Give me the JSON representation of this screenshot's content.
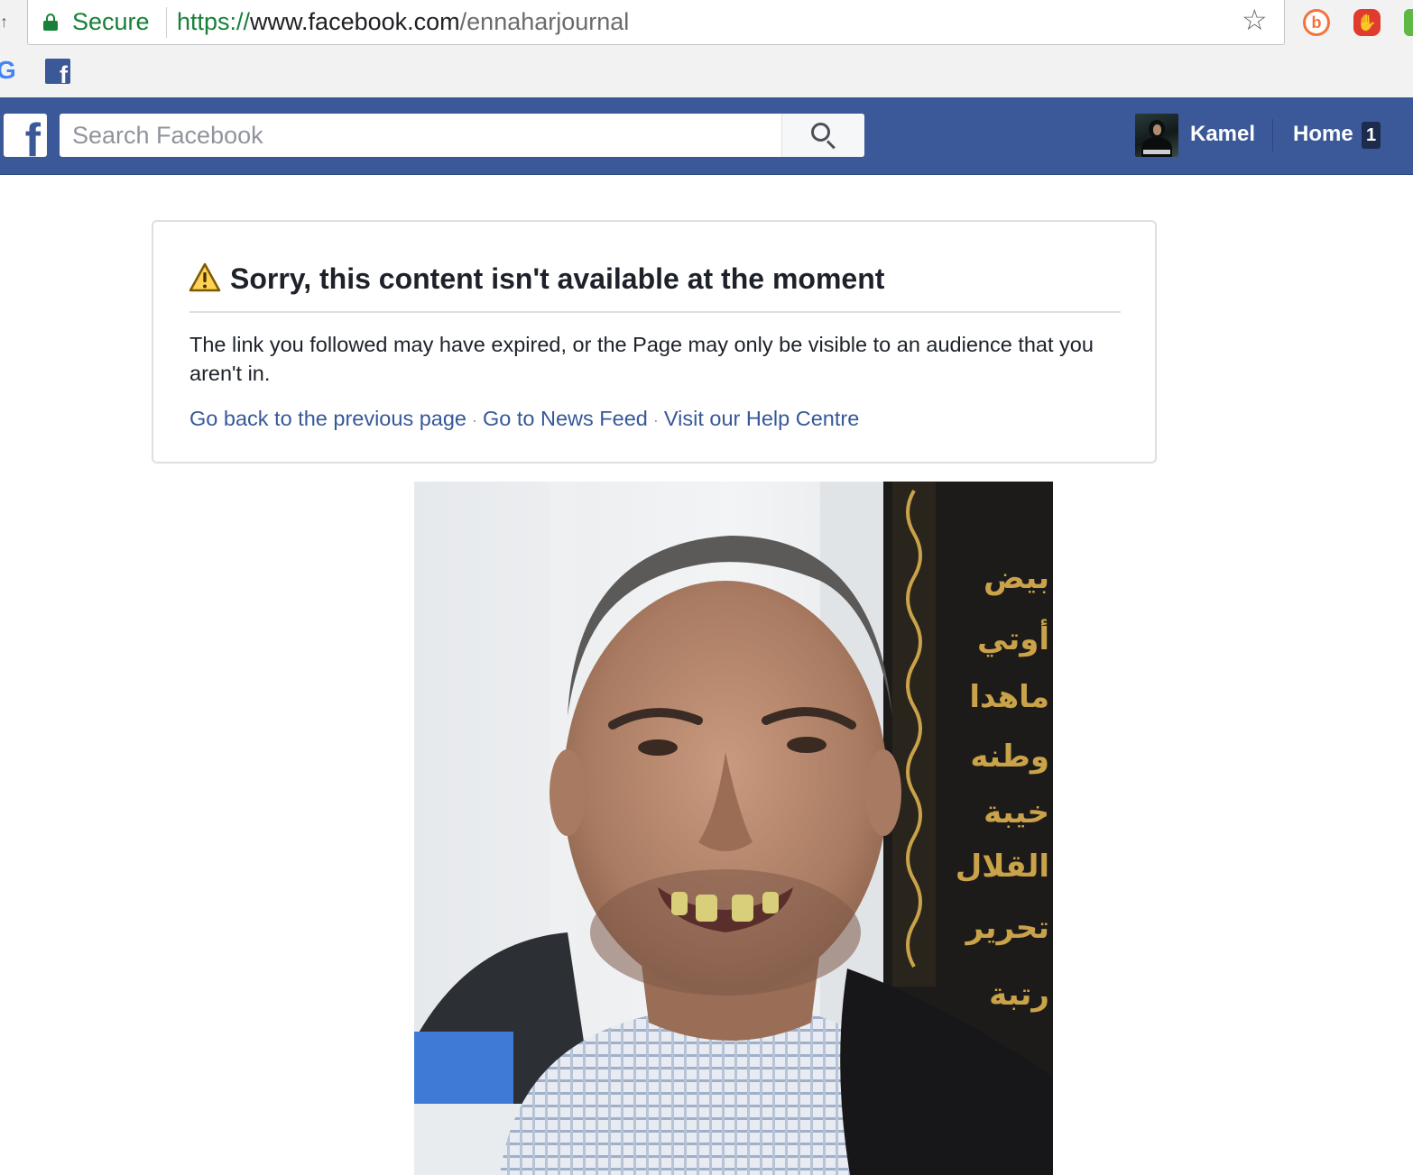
{
  "browser": {
    "secure_label": "Secure",
    "url_scheme": "https://",
    "url_host": "www.facebook.com",
    "url_path": "/ennaharjournal",
    "bookmarks": [
      "google-bookmark",
      "facebook-bookmark"
    ],
    "extensions": [
      "bitly-extension",
      "adblock-extension",
      "privacy-extension"
    ]
  },
  "fb_header": {
    "search_placeholder": "Search Facebook",
    "user_name": "Kamel",
    "home_label": "Home",
    "home_badge": "1",
    "brand_color": "#3b5998"
  },
  "error": {
    "title": "Sorry, this content isn't available at the moment",
    "message": "The link you followed may have expired, or the Page may only be visible to an audience that you aren't in.",
    "links": [
      "Go back to the previous page",
      "Go to News Feed",
      "Visit our Help Centre"
    ],
    "link_color": "#365899"
  },
  "photo": {
    "visible_text": [
      "بيض",
      "أوتي",
      "ماهدا",
      "وطنه",
      "خيبة",
      "القلال",
      "تحرير",
      "رتبة"
    ]
  }
}
